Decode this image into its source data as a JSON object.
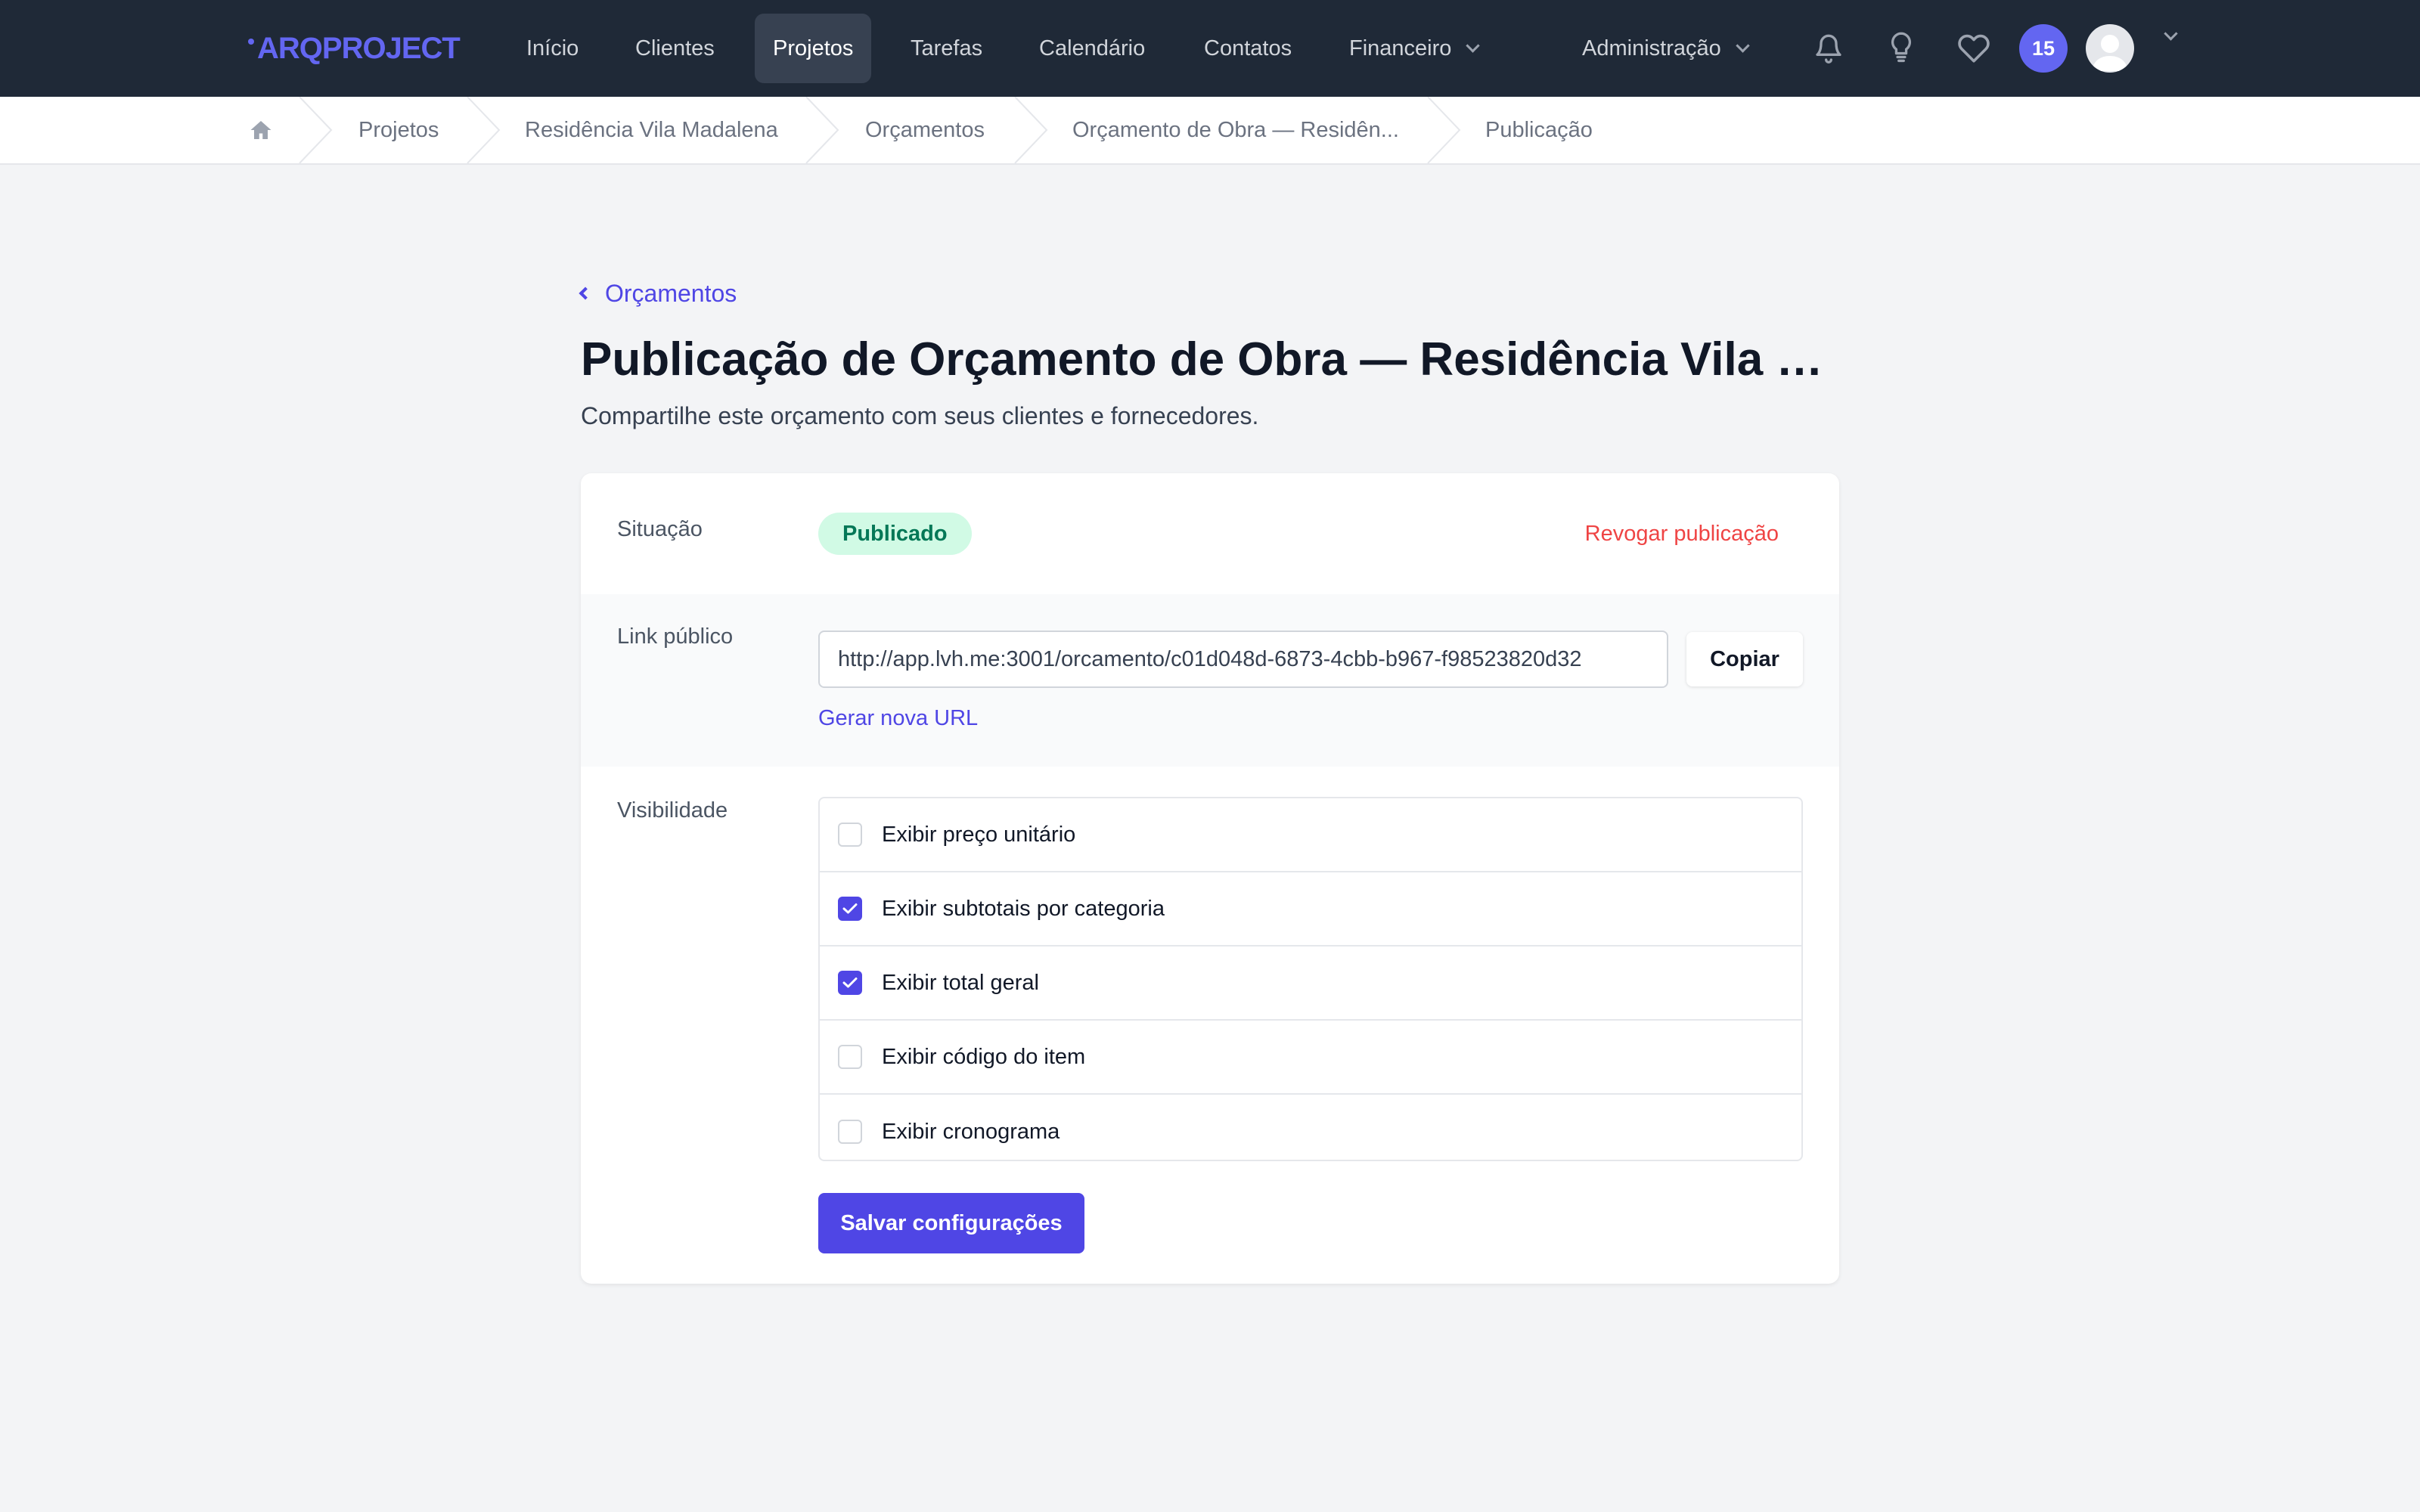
{
  "brand": {
    "name": "ARQPROJECT",
    "accent": "#6366f1"
  },
  "nav": {
    "items": [
      {
        "label": "Início"
      },
      {
        "label": "Clientes"
      },
      {
        "label": "Projetos",
        "active": true
      },
      {
        "label": "Tarefas"
      },
      {
        "label": "Calendário"
      },
      {
        "label": "Contatos"
      },
      {
        "label": "Financeiro",
        "dropdown": true
      }
    ],
    "admin": "Administração",
    "icons": [
      "bell-icon",
      "lightbulb-icon",
      "heart-icon"
    ],
    "notification_count": "15"
  },
  "breadcrumb": [
    {
      "label": "home-icon"
    },
    {
      "label": "Projetos"
    },
    {
      "label": "Residência Vila Madalena"
    },
    {
      "label": "Orçamentos"
    },
    {
      "label": "Orçamento de Obra — Residên..."
    },
    {
      "label": "Publicação"
    }
  ],
  "page": {
    "back_label": "Orçamentos",
    "title": "Publicação de Orçamento de Obra — Residência Vila M...",
    "subtitle": "Compartilhe este orçamento com seus clientes e fornecedores."
  },
  "status": {
    "label": "Situação",
    "value": "Publicado",
    "revoke_label": "Revogar publicação"
  },
  "link": {
    "label": "Link público",
    "url": "http://app.lvh.me:3001/orcamento/c01d048d-6873-4cbb-b967-f98523820d32",
    "copy_label": "Copiar",
    "regenerate_label": "Gerar nova URL"
  },
  "visibility": {
    "label": "Visibilidade",
    "options": [
      {
        "label": "Exibir preço unitário",
        "checked": false
      },
      {
        "label": "Exibir subtotais por categoria",
        "checked": true
      },
      {
        "label": "Exibir total geral",
        "checked": true
      },
      {
        "label": "Exibir código do item",
        "checked": false
      },
      {
        "label": "Exibir cronograma",
        "checked": false
      }
    ]
  },
  "save_label": "Salvar configurações"
}
